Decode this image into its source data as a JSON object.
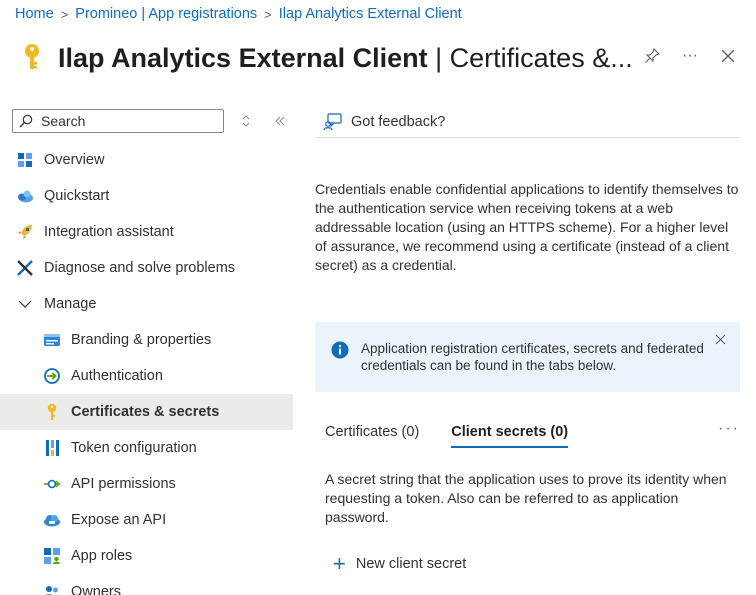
{
  "breadcrumb": {
    "items": [
      "Home",
      "Promineo | App registrations",
      "Ilap Analytics External Client"
    ]
  },
  "header": {
    "title_bold": "Ilap Analytics External Client",
    "title_sep": " | ",
    "title_rest": "Certificates &...",
    "actions": {
      "pin_icon": "pin-icon",
      "more": "···",
      "close": "✕"
    }
  },
  "sidebar": {
    "search_placeholder": "Search",
    "items": [
      {
        "label": "Overview",
        "icon": "overview-icon"
      },
      {
        "label": "Quickstart",
        "icon": "quickstart-icon"
      },
      {
        "label": "Integration assistant",
        "icon": "rocket-icon"
      },
      {
        "label": "Diagnose and solve problems",
        "icon": "wrench-icon"
      },
      {
        "label": "Manage",
        "icon": "chevron-down-icon"
      },
      {
        "label": "Branding & properties",
        "icon": "branding-icon"
      },
      {
        "label": "Authentication",
        "icon": "authentication-icon"
      },
      {
        "label": "Certificates & secrets",
        "icon": "key-icon"
      },
      {
        "label": "Token configuration",
        "icon": "token-icon"
      },
      {
        "label": "API permissions",
        "icon": "api-permissions-icon"
      },
      {
        "label": "Expose an API",
        "icon": "cloud-icon"
      },
      {
        "label": "App roles",
        "icon": "app-roles-icon"
      },
      {
        "label": "Owners",
        "icon": "owners-icon"
      }
    ]
  },
  "main": {
    "feedback_label": "Got feedback?",
    "description": "Credentials enable confidential applications to identify themselves to the authentication service when receiving tokens at a web addressable location (using an HTTPS scheme). For a higher level of assurance, we recommend using a certificate (instead of a client secret) as a credential.",
    "info_banner": "Application registration certificates, secrets and federated credentials can be found in the tabs below.",
    "tabs": [
      {
        "label": "Certificates (0)"
      },
      {
        "label": "Client secrets (0)"
      }
    ],
    "more": "···",
    "secret_description": "A secret string that the application uses to prove its identity when requesting a token. Also can be referred to as application password.",
    "new_secret_label": "New client secret"
  },
  "colors": {
    "accent": "#0f6cbd",
    "selected_bg": "#edebe9",
    "info_bg": "#ebf3fc",
    "key": "#f2b824"
  }
}
